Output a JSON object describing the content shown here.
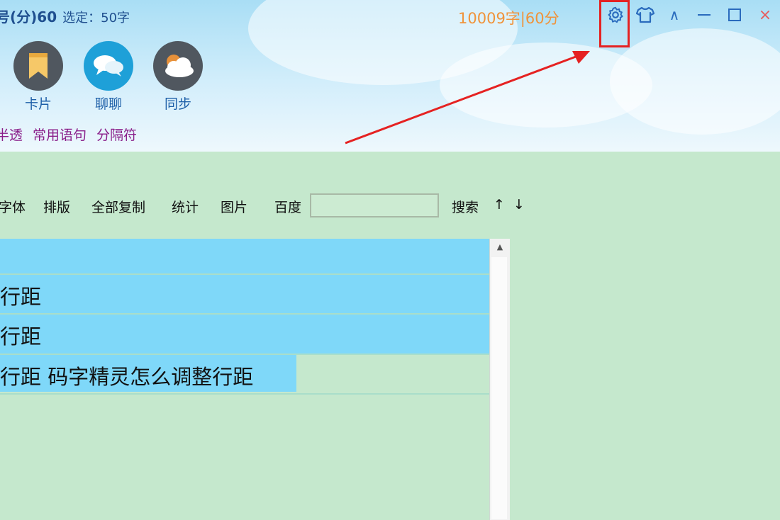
{
  "header": {
    "title": "号(分)60",
    "selection": "选定：50字",
    "stats": "10009字|60分"
  },
  "window_controls": {
    "settings_icon": "gear-icon",
    "skin_icon": "shirt-icon",
    "collapse_icon": "∧",
    "minimize_icon": "—",
    "maximize_icon": "☐",
    "close_icon": "×"
  },
  "tools": [
    {
      "label": "卡片",
      "icon": "bookmark-icon",
      "color": "#f6c868"
    },
    {
      "label": "聊聊",
      "icon": "chat-icon",
      "color": "#1ea0d8"
    },
    {
      "label": "同步",
      "icon": "cloud-sun-icon",
      "color": "#e8913a"
    }
  ],
  "links": [
    "半透",
    "常用语句",
    "分隔符"
  ],
  "toolbar": {
    "font": "字体",
    "layout": "排版",
    "copy_all": "全部复制",
    "stats": "统计",
    "image": "图片",
    "baidu": "百度",
    "search_value": "",
    "search": "搜索",
    "up": "↑",
    "down": "↓"
  },
  "editor": {
    "lines": [
      "行距",
      "行距",
      "行距 码字精灵怎么调整行距"
    ]
  },
  "colors": {
    "background": "#c5e8cd",
    "selection": "#7fd8f9",
    "annotation": "#e52222",
    "stats": "#f0933a"
  }
}
